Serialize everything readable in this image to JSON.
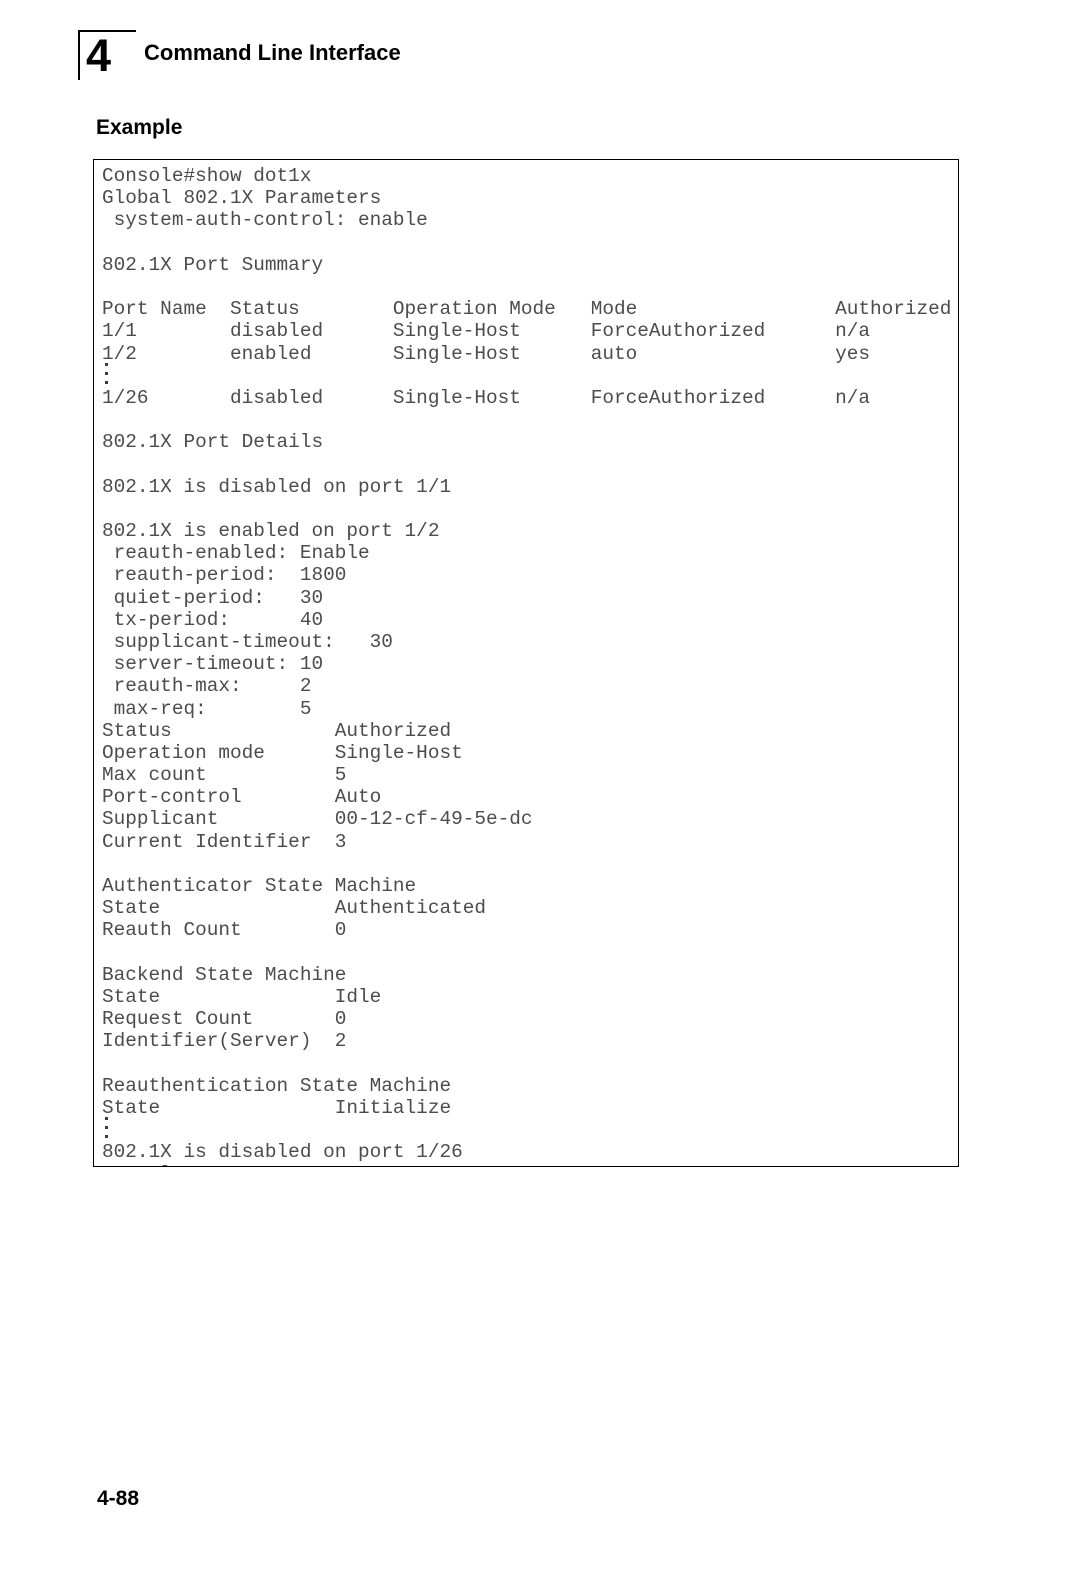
{
  "header": {
    "chapter_number": "4",
    "title": "Command Line Interface"
  },
  "section": {
    "heading": "Example"
  },
  "footer": {
    "page_number": "4-88"
  },
  "terminal": {
    "prompt_command": "Console#show dot1x",
    "lines": [
      "Console#show dot1x",
      "Global 802.1X Parameters",
      " system-auth-control: enable",
      "",
      "802.1X Port Summary",
      "",
      "Port Name  Status        Operation Mode   Mode                 Authorized",
      "1/1        disabled      Single-Host      ForceAuthorized      n/a",
      "1/2        enabled       Single-Host      auto                 yes",
      "⋮",
      "1/26       disabled      Single-Host      ForceAuthorized      n/a",
      "",
      "802.1X Port Details",
      "",
      "802.1X is disabled on port 1/1",
      "",
      "802.1X is enabled on port 1/2",
      " reauth-enabled: Enable",
      " reauth-period:  1800",
      " quiet-period:   30",
      " tx-period:      40",
      " supplicant-timeout:   30",
      " server-timeout: 10",
      " reauth-max:     2",
      " max-req:        5",
      "Status              Authorized",
      "Operation mode      Single-Host",
      "Max count           5",
      "Port-control        Auto",
      "Supplicant          00-12-cf-49-5e-dc",
      "Current Identifier  3",
      "",
      "Authenticator State Machine",
      "State               Authenticated",
      "Reauth Count        0",
      "",
      "Backend State Machine",
      "State               Idle",
      "Request Count       0",
      "Identifier(Server)  2",
      "",
      "Reauthentication State Machine",
      "State               Initialize",
      "⋮",
      "802.1X is disabled on port 1/26",
      "Console#"
    ],
    "port_summary": {
      "title": "802.1X Port Summary",
      "columns": [
        "Port Name",
        "Status",
        "Operation Mode",
        "Mode",
        "Authorized"
      ],
      "rows": [
        [
          "1/1",
          "disabled",
          "Single-Host",
          "ForceAuthorized",
          "n/a"
        ],
        [
          "1/2",
          "enabled",
          "Single-Host",
          "auto",
          "yes"
        ],
        [
          "⋮",
          "",
          "",
          "",
          ""
        ],
        [
          "1/26",
          "disabled",
          "Single-Host",
          "ForceAuthorized",
          "n/a"
        ]
      ]
    },
    "global_parameters": {
      "title": "Global 802.1X Parameters",
      "system_auth_control": "enable"
    },
    "port_details": {
      "title": "802.1X Port Details",
      "port_1_1_status": "802.1X is disabled on port 1/1",
      "port_1_2_status": "802.1X is enabled on port 1/2",
      "parameters": [
        {
          "key": "reauth-enabled:",
          "value": "Enable"
        },
        {
          "key": "reauth-period:",
          "value": "1800"
        },
        {
          "key": "quiet-period:",
          "value": "30"
        },
        {
          "key": "tx-period:",
          "value": "40"
        },
        {
          "key": "supplicant-timeout:",
          "value": "30"
        },
        {
          "key": "server-timeout:",
          "value": "10"
        },
        {
          "key": "reauth-max:",
          "value": "2"
        },
        {
          "key": "max-req:",
          "value": "5"
        }
      ],
      "status_fields": [
        {
          "key": "Status",
          "value": "Authorized"
        },
        {
          "key": "Operation mode",
          "value": "Single-Host"
        },
        {
          "key": "Max count",
          "value": "5"
        },
        {
          "key": "Port-control",
          "value": "Auto"
        },
        {
          "key": "Supplicant",
          "value": "00-12-cf-49-5e-dc"
        },
        {
          "key": "Current Identifier",
          "value": "3"
        }
      ],
      "authenticator_state_machine": {
        "title": "Authenticator State Machine",
        "fields": [
          {
            "key": "State",
            "value": "Authenticated"
          },
          {
            "key": "Reauth Count",
            "value": "0"
          }
        ]
      },
      "backend_state_machine": {
        "title": "Backend State Machine",
        "fields": [
          {
            "key": "State",
            "value": "Idle"
          },
          {
            "key": "Request Count",
            "value": "0"
          },
          {
            "key": "Identifier(Server)",
            "value": "2"
          }
        ]
      },
      "reauthentication_state_machine": {
        "title": "Reauthentication State Machine",
        "fields": [
          {
            "key": "State",
            "value": "Initialize"
          }
        ]
      },
      "port_1_26_status": "802.1X is disabled on port 1/26",
      "final_prompt": "Console#"
    }
  },
  "colors": {
    "page_background": "#ffffff",
    "text": "#000000",
    "terminal_text": "#4c4c4c",
    "border": "#000000"
  }
}
